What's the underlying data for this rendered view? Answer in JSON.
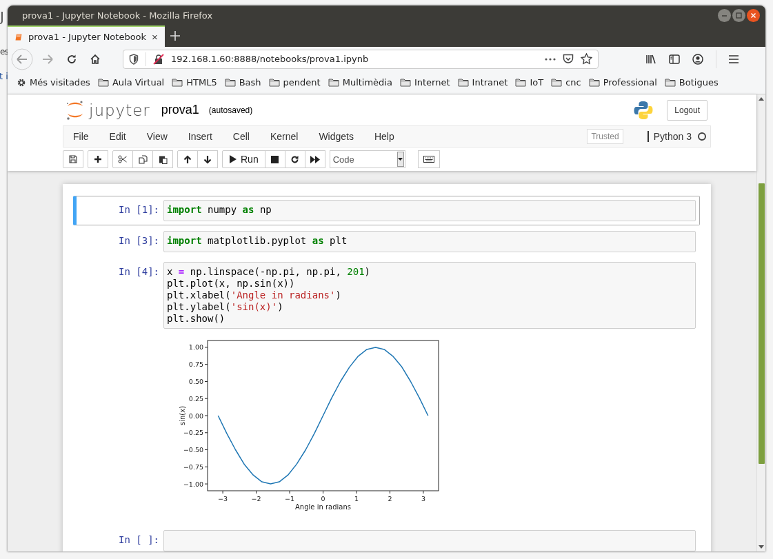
{
  "background_window": {
    "fragments": [
      "J",
      "es",
      "t i"
    ]
  },
  "window": {
    "title": "prova1 - Jupyter Notebook - Mozilla Firefox"
  },
  "tabs": [
    {
      "label": "prova1 - Jupyter Notebook",
      "selected": true
    }
  ],
  "address_bar": {
    "value": "192.168.1.60:8888/notebooks/prova1.ipynb"
  },
  "bookmarks": [
    {
      "label": "Més visitades",
      "kind": "gear"
    },
    {
      "label": "Aula Virtual",
      "kind": "folder"
    },
    {
      "label": "HTML5",
      "kind": "folder"
    },
    {
      "label": "Bash",
      "kind": "folder"
    },
    {
      "label": "pendent",
      "kind": "folder"
    },
    {
      "label": "Multimèdia",
      "kind": "folder"
    },
    {
      "label": "Internet",
      "kind": "folder"
    },
    {
      "label": "Intranet",
      "kind": "folder"
    },
    {
      "label": "IoT",
      "kind": "folder"
    },
    {
      "label": "cnc",
      "kind": "folder"
    },
    {
      "label": "Professional",
      "kind": "folder"
    },
    {
      "label": "Botigues",
      "kind": "folder"
    }
  ],
  "notebook": {
    "logo_text": "jupyter",
    "name": "prova1",
    "save_status": "(autosaved)",
    "logout": "Logout",
    "menu": [
      "File",
      "Edit",
      "View",
      "Insert",
      "Cell",
      "Kernel",
      "Widgets",
      "Help"
    ],
    "trusted": "Trusted",
    "kernel": "Python 3",
    "kernel_busy": false,
    "run_label": "Run",
    "cell_type": "Code"
  },
  "cells": [
    {
      "prompt": "In [1]:",
      "selected": true,
      "lines": [
        [
          {
            "t": "import",
            "kind": "kw"
          },
          {
            "t": " numpy ",
            "kind": "plain"
          },
          {
            "t": "as",
            "kind": "kw"
          },
          {
            "t": " np",
            "kind": "plain"
          }
        ]
      ]
    },
    {
      "prompt": "In [3]:",
      "selected": false,
      "lines": [
        [
          {
            "t": "import",
            "kind": "kw"
          },
          {
            "t": " matplotlib.pyplot ",
            "kind": "plain"
          },
          {
            "t": "as",
            "kind": "kw"
          },
          {
            "t": " plt",
            "kind": "plain"
          }
        ]
      ]
    },
    {
      "prompt": "In [4]:",
      "selected": false,
      "lines": [
        [
          {
            "t": "x ",
            "kind": "plain"
          },
          {
            "t": "=",
            "kind": "op"
          },
          {
            "t": " np.linspace(-np.pi, np.pi, ",
            "kind": "plain"
          },
          {
            "t": "201",
            "kind": "num"
          },
          {
            "t": ")",
            "kind": "plain"
          }
        ],
        [
          {
            "t": "plt.plot(x, np.sin(x))",
            "kind": "plain"
          }
        ],
        [
          {
            "t": "plt.xlabel(",
            "kind": "plain"
          },
          {
            "t": "'Angle in radians'",
            "kind": "str"
          },
          {
            "t": ")",
            "kind": "plain"
          }
        ],
        [
          {
            "t": "plt.ylabel(",
            "kind": "plain"
          },
          {
            "t": "'sin(x)'",
            "kind": "str"
          },
          {
            "t": ")",
            "kind": "plain"
          }
        ],
        [
          {
            "t": "plt.show()",
            "kind": "plain"
          }
        ]
      ],
      "output": {
        "chart_data": {
          "type": "line",
          "xlabel": "Angle in radians",
          "ylabel": "sin(x)",
          "x": [
            -3.14,
            -2.88,
            -2.62,
            -2.36,
            -2.09,
            -1.83,
            -1.57,
            -1.31,
            -1.05,
            -0.79,
            -0.52,
            -0.26,
            0,
            0.26,
            0.52,
            0.79,
            1.05,
            1.31,
            1.57,
            1.83,
            2.09,
            2.36,
            2.62,
            2.88,
            3.14
          ],
          "series": [
            {
              "color": "#1f77b4",
              "values": [
                0,
                -0.26,
                -0.5,
                -0.71,
                -0.87,
                -0.97,
                -1,
                -0.97,
                -0.87,
                -0.71,
                -0.5,
                -0.26,
                0,
                0.26,
                0.5,
                0.71,
                0.87,
                0.97,
                1,
                0.97,
                0.87,
                0.71,
                0.5,
                0.26,
                0
              ]
            }
          ],
          "xlim": [
            -3.456,
            3.456
          ],
          "ylim": [
            -1.1,
            1.1
          ],
          "xticks": [
            {
              "value": -3,
              "label": "−3"
            },
            {
              "value": -2,
              "label": "−2"
            },
            {
              "value": -1,
              "label": "−1"
            },
            0,
            1,
            2,
            3
          ],
          "yticks": [
            {
              "value": 1,
              "label": "1.00"
            },
            {
              "value": 0.75,
              "label": "0.75"
            },
            {
              "value": 0.5,
              "label": "0.50"
            },
            {
              "value": 0.25,
              "label": "0.25"
            },
            {
              "value": 0,
              "label": "0.00"
            },
            {
              "value": -0.25,
              "label": "−0.25"
            },
            {
              "value": -0.5,
              "label": "−0.50"
            },
            {
              "value": -0.75,
              "label": "−0.75"
            },
            {
              "value": -1,
              "label": "−1.00"
            }
          ]
        }
      }
    },
    {
      "prompt": "In [ ]:",
      "selected": false
    }
  ]
}
